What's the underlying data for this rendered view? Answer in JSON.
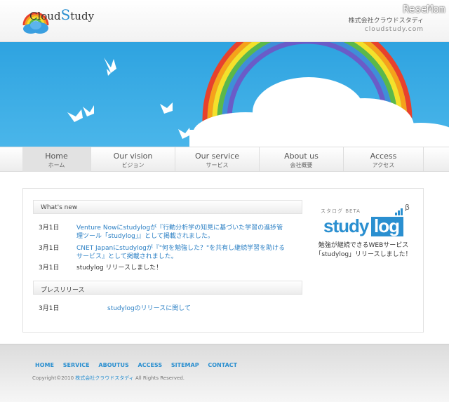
{
  "header": {
    "logo_text_a": "Cloud",
    "logo_text_s": "S",
    "logo_text_b": "tudy",
    "company_name": "株式会社クラウドスタディ",
    "company_url": "cloudstudy.com",
    "watermark": "ReseMom"
  },
  "nav": [
    {
      "label": "Home",
      "sub": "ホーム",
      "active": true
    },
    {
      "label": "Our vision",
      "sub": "ビジョン"
    },
    {
      "label": "Our service",
      "sub": "サービス"
    },
    {
      "label": "About us",
      "sub": "会社概要"
    },
    {
      "label": "Access",
      "sub": "アクセス"
    }
  ],
  "news": {
    "heading": "What's new",
    "items": [
      {
        "date": "3月1日",
        "text": "Venture Nowにstudylogが『行動分析学の知見に基づいた学習の進捗管理ツール「studylog」』として掲載されました。"
      },
      {
        "date": "3月1日",
        "text": "CNET Japanにstudylogが『\"何を勉強した？\"を共有し継続学習を助けるサービス』として掲載されました。"
      },
      {
        "date": "3月1日",
        "text": "studylog リリースしました！"
      }
    ]
  },
  "press": {
    "heading": "プレスリリース",
    "items": [
      {
        "date": "3月1日",
        "text": "studylogのリリースに関して"
      }
    ]
  },
  "promo": {
    "beta_label": "スタログ BETA",
    "greek": "β",
    "logo_study": "study",
    "logo_log": "log",
    "line1": "勉強が継続できるWEBサービス",
    "line2": "「studylog」リリースしました！"
  },
  "footer": {
    "links": [
      "HOME",
      "SERVICE",
      "ABOUTUS",
      "ACCESS",
      "SITEMAP",
      "CONTACT"
    ],
    "copyright_pre": "Copyright©2010",
    "copyright_company": "株式会社クラウドスタディ",
    "copyright_post": "All Rights Reserved."
  },
  "colors": {
    "accent": "#2a8fd0",
    "sky": "#3aaee6"
  }
}
